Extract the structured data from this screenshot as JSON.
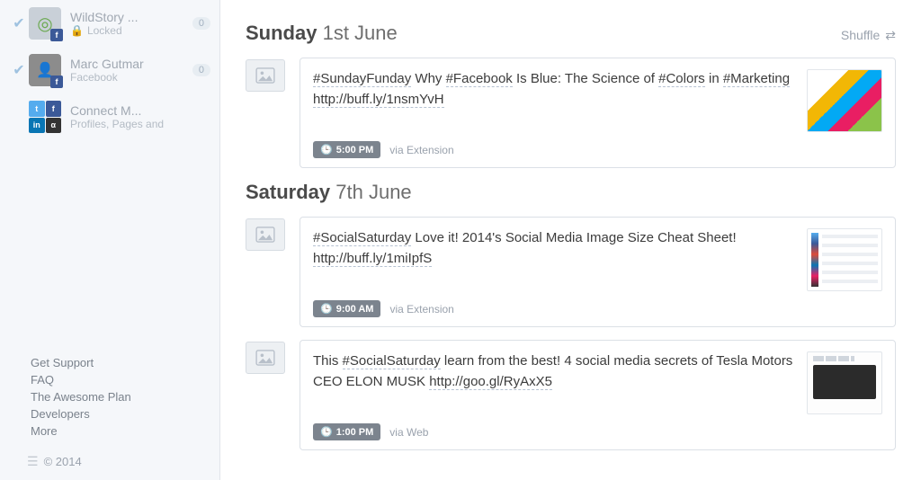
{
  "sidebar": {
    "accounts": [
      {
        "name": "WildStory ...",
        "sub": "Locked",
        "locked": true,
        "count": "0",
        "checked": true,
        "net": "f"
      },
      {
        "name": "Marc Gutmar",
        "sub": "Facebook",
        "locked": false,
        "count": "0",
        "checked": true,
        "net": "f"
      }
    ],
    "connect": {
      "name": "Connect M...",
      "sub": "Profiles, Pages and"
    }
  },
  "footer": {
    "links": [
      "Get Support",
      "FAQ",
      "The Awesome Plan",
      "Developers",
      "More"
    ],
    "copyright": "© 2014"
  },
  "days": [
    {
      "strong": "Sunday",
      "light": "1st June",
      "shuffle": "Shuffle",
      "posts": [
        {
          "text_segments": [
            {
              "t": "#SundayFunday",
              "hl": true
            },
            {
              "t": " Why ",
              "hl": false
            },
            {
              "t": "#Facebook",
              "hl": true
            },
            {
              "t": " Is Blue: The Science of ",
              "hl": false
            },
            {
              "t": "#Colors",
              "hl": true
            },
            {
              "t": " in ",
              "hl": false
            },
            {
              "t": "#Marketing",
              "hl": true
            },
            {
              "t": " ",
              "hl": false
            },
            {
              "t": "http://buff.ly/1nsmYvH",
              "link": true
            }
          ],
          "time": "5:00 PM",
          "via": "via Extension",
          "thumb": "thumb1"
        }
      ]
    },
    {
      "strong": "Saturday",
      "light": "7th June",
      "posts": [
        {
          "text_segments": [
            {
              "t": "#SocialSaturday",
              "hl": true
            },
            {
              "t": " Love it! 2014's Social Media Image Size Cheat Sheet! ",
              "hl": false
            },
            {
              "t": "http://buff.ly/1miIpfS",
              "link": true
            }
          ],
          "time": "9:00 AM",
          "via": "via Extension",
          "thumb": "thumb2"
        },
        {
          "text_segments": [
            {
              "t": "This ",
              "hl": false
            },
            {
              "t": "#SocialSaturday",
              "hl": true
            },
            {
              "t": " learn from the best! 4 social media secrets of Tesla Motors CEO ELON MUSK ",
              "hl": false
            },
            {
              "t": "http://goo.gl/RyAxX5",
              "link": true
            }
          ],
          "time": "1:00 PM",
          "via": "via Web",
          "thumb": "thumb3"
        }
      ]
    }
  ]
}
